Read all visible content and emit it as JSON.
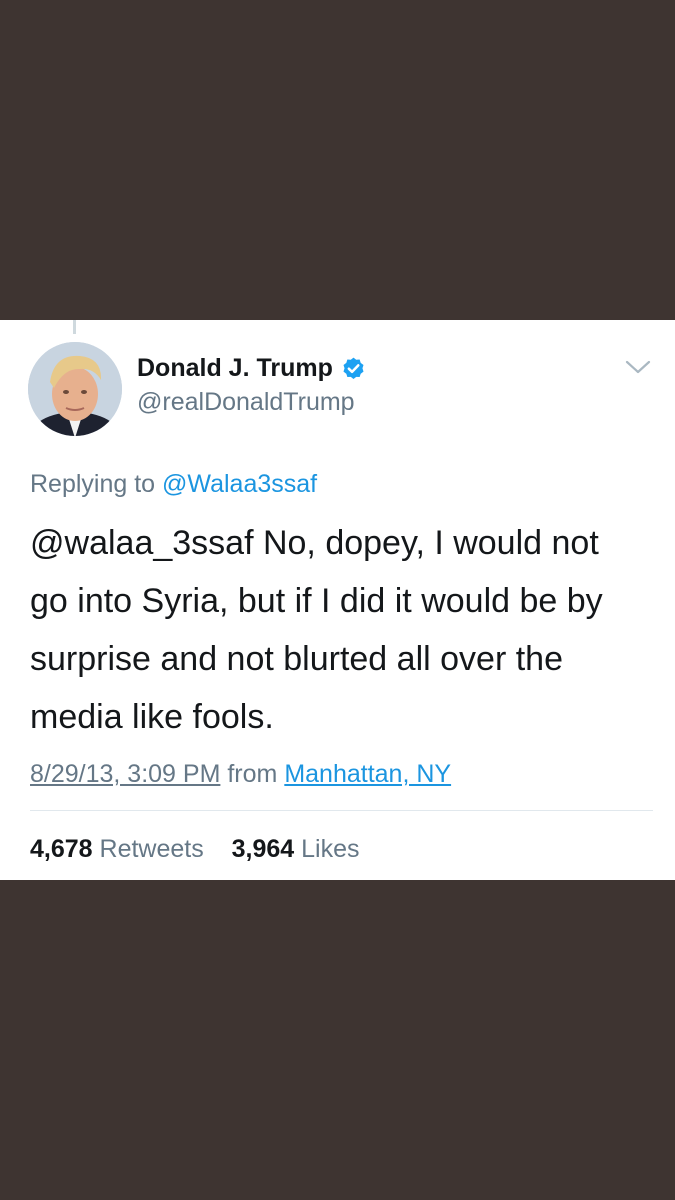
{
  "tweet": {
    "author": {
      "display_name": "Donald J. Trump",
      "handle": "@realDonaldTrump",
      "verified": true
    },
    "reply_to": {
      "prefix": "Replying to",
      "handle": "@Walaa3ssaf"
    },
    "text_lines": [
      "@walaa_3ssaf   No, dopey, I would not",
      "go into Syria, but if I did it would be by",
      "surprise and not blurted all over the",
      "media like fools."
    ],
    "timestamp": "8/29/13, 3:09 PM",
    "from_label": "from",
    "location": "Manhattan, NY",
    "stats": {
      "retweets_count": "4,678",
      "retweets_label": "Retweets",
      "likes_count": "3,964",
      "likes_label": "Likes"
    }
  },
  "icons": {
    "verified": "verified-badge-icon",
    "menu": "chevron-down-icon"
  },
  "colors": {
    "background": "#3e3431",
    "card": "#ffffff",
    "link": "#1b95e0",
    "muted": "#657786",
    "text": "#14171a"
  }
}
